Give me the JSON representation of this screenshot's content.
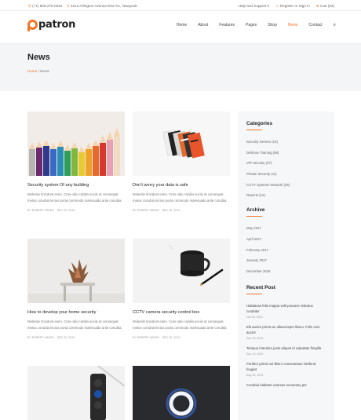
{
  "topbar": {
    "phone": "(+1) 828-276-0322",
    "address": "4214 Arlington Avenue Des Arc, Newyouk",
    "help": "Help and Support",
    "register": "Register",
    "or": "or",
    "signin": "Sign in",
    "cart": "Cart (03)"
  },
  "brand": {
    "name": "patron"
  },
  "nav": [
    "Home",
    "About",
    "Features",
    "Pages",
    "Shop",
    "News",
    "Contact"
  ],
  "page": {
    "title": "News",
    "crumb_home": "Home",
    "crumb_sep": "/",
    "crumb_current": "News"
  },
  "posts": [
    {
      "title": "Security system Of any building",
      "excerpt": "Molestie tincidunt enim. Cras odio cubilia sociis at consequat metus conubia lectus porta commodo malesuada ante conubia.",
      "author": "BY ROBERT HAVEN",
      "date": "DEC 20, 2019",
      "image": "colored-pencils"
    },
    {
      "title": "Don't worry your data is safe",
      "excerpt": "Molestie tincidunt enim. Cras odio cubilia sociis at consequat metus conubia lectus porta commodo malesuada ante conubia.",
      "author": "BY ROBERT HAVEN",
      "date": "DEC 20, 2019",
      "image": "business-cards"
    },
    {
      "title": "How to develop your home security",
      "excerpt": "Molestie tincidunt enim. Cras odio cubilia sociis at consequat metus conubia lectus porta commodo malesuada ante conubia.",
      "author": "BY ROBERT HAVEN",
      "date": "DEC 20, 2019",
      "image": "table-flower"
    },
    {
      "title": "CCTV camera security control box",
      "excerpt": "Molestie tincidunt enim. Cras odio cubilia sociis at consequat metus conubia lectus porta commodo malesuada ante conubia.",
      "author": "BY ROBERT HAVEN",
      "date": "DEC 20, 2019",
      "image": "mug-pen"
    },
    {
      "image": "traffic-light"
    },
    {
      "image": "light-ring"
    }
  ],
  "sidebar": {
    "categories_title": "Categories",
    "categories": [
      "Security Service (10)",
      "Defense Training (08)",
      "VIP Security (07)",
      "Private Security (11)",
      "CCTV Systems Network (05)",
      "Reports (12)"
    ],
    "archive_title": "Archive",
    "archive": [
      "May 2017",
      "April 2017",
      "February 2017",
      "January 2017",
      "December 2016"
    ],
    "recent_title": "Recent Post",
    "recent": [
      {
        "title": "Habitasse felis magna velit posuere ridiculus curabitur",
        "date": "Oct 05, 2019"
      },
      {
        "title": "Elit auctor primis ac ullamcorper libero. Felis erat auctor",
        "date": "Sep 05, 2019"
      },
      {
        "title": "Tempus interdum justo aliquet id vulputate fringilla",
        "date": "Sep 10, 2019"
      },
      {
        "title": "Porttitor primis vel libero consectetuer eleifend feugiat",
        "date": "Aug 05, 2019"
      },
      {
        "title": "Conubia habitant vivamus nonummy per"
      }
    ]
  },
  "colors": {
    "accent": "#f0762a",
    "banner_bg": "#f4f5f7",
    "sidebar_bg": "#f6f7f9"
  }
}
